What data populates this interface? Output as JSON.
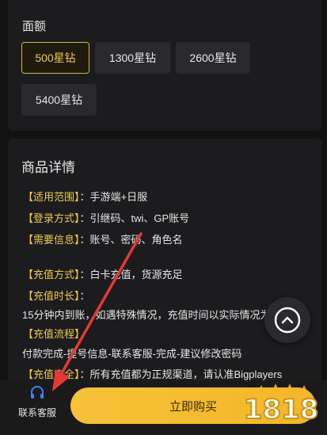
{
  "denomination": {
    "title": "面额",
    "options": [
      {
        "label": "500星钻",
        "selected": true
      },
      {
        "label": "1300星钻",
        "selected": false
      },
      {
        "label": "2600星钻",
        "selected": false
      },
      {
        "label": "5400星钻",
        "selected": false
      }
    ]
  },
  "details": {
    "title": "商品详情",
    "rows": [
      {
        "key": "【适用范围】",
        "value": "：手游端+日服"
      },
      {
        "key": "【登录方式】",
        "value": "：引继码、twi、GP账号"
      },
      {
        "key": "【需要信息】",
        "value": "：账号、密码、角色名"
      },
      {
        "key": "【充值方式】",
        "value": "：白卡充值，货源充足"
      },
      {
        "key": "【充值时长】",
        "value": "："
      },
      {
        "key": "",
        "value": "15分钟内到账，如遇特殊情况，充值时间以实际情况为"
      },
      {
        "key": "【充值流程】",
        "value": ""
      },
      {
        "key": "",
        "value": "付款完成-提号信息-联系客服-完成-建议修改密码"
      },
      {
        "key": "【充值安全】",
        "value": "：所有充值都为正规渠道，请认准Bigplayers"
      }
    ]
  },
  "bottom_bar": {
    "customer_service_label": "联系客服",
    "buy_label": "立即购买"
  },
  "watermark": "1818",
  "colors": {
    "accent_gold": "#f0c94b",
    "buy_button": "#f6c23a",
    "annotation_arrow": "#e53935",
    "background": "#121212",
    "card": "#1c1c1f"
  },
  "icons": {
    "scroll_top": "chevron-up-icon",
    "customer_service": "headset-icon"
  }
}
